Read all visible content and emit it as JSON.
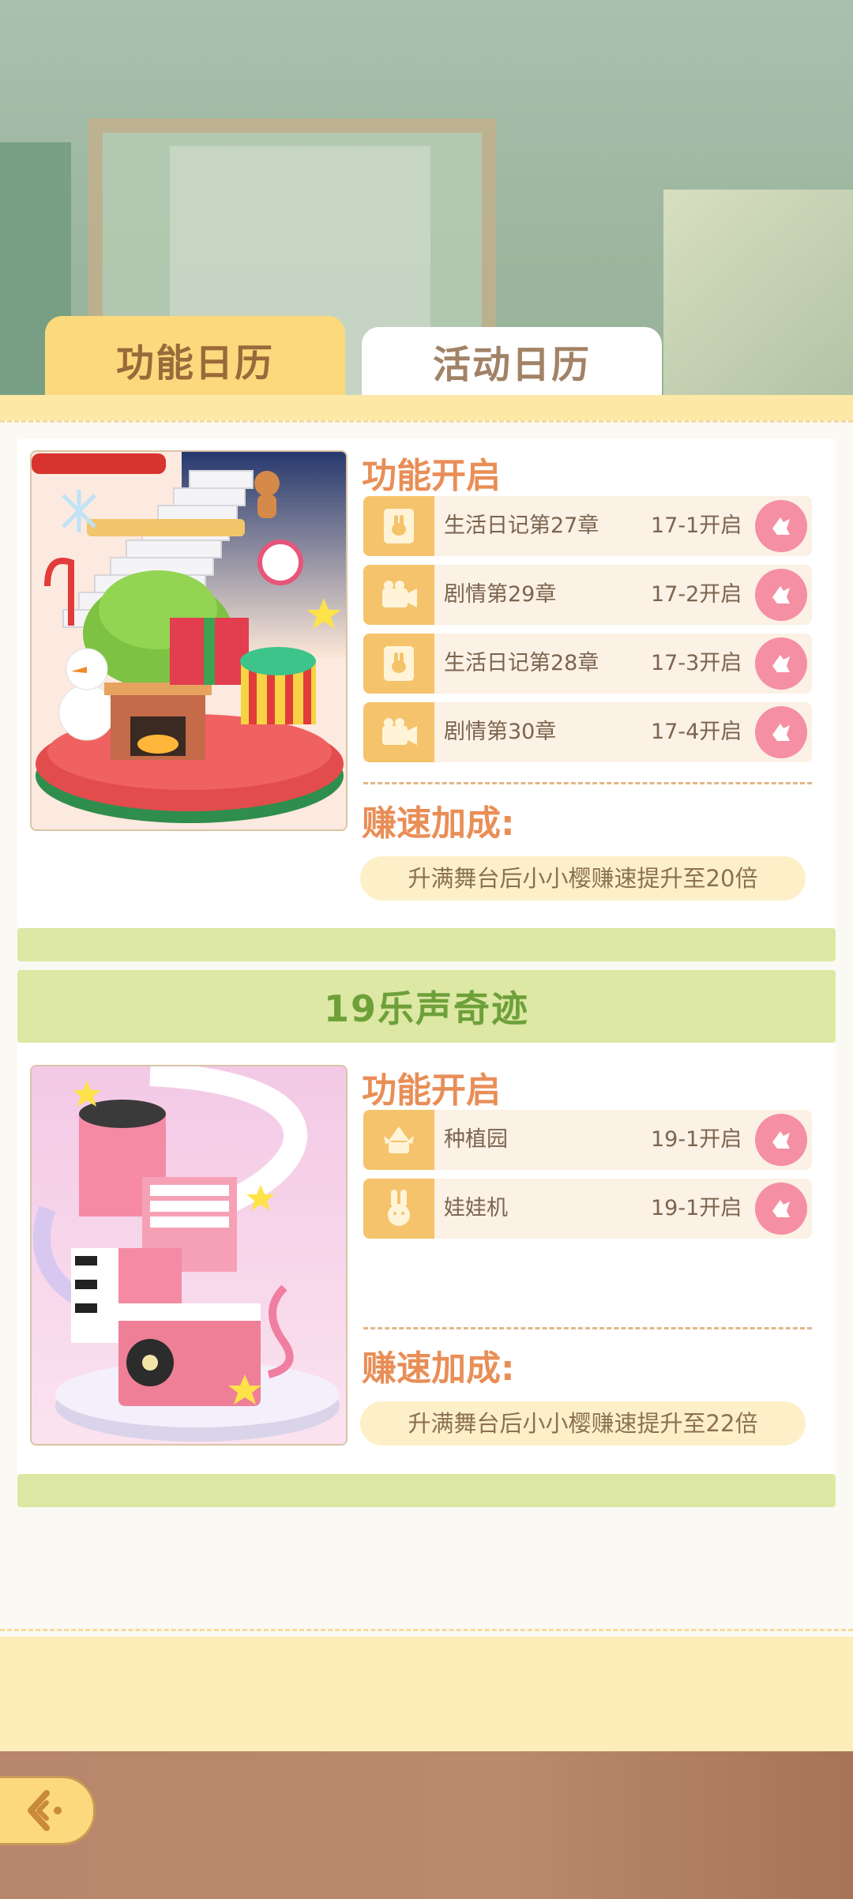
{
  "tabs": [
    {
      "label": "功能日历",
      "active": true
    },
    {
      "label": "活动日历",
      "active": false
    }
  ],
  "sections": [
    {
      "title": "",
      "image": "christmas-stage-image",
      "feature_heading": "功能开启",
      "features": [
        {
          "icon": "rabbit-diary-icon",
          "name": "生活日记第27章",
          "open": "17-1开启"
        },
        {
          "icon": "camera-icon",
          "name": "剧情第29章",
          "open": "17-2开启"
        },
        {
          "icon": "rabbit-diary-icon",
          "name": "生活日记第28章",
          "open": "17-3开启"
        },
        {
          "icon": "camera-icon",
          "name": "剧情第30章",
          "open": "17-4开启"
        }
      ],
      "speed_heading": "赚速加成:",
      "speed_text": "升满舞台后小小樱赚速提升至20倍"
    },
    {
      "title": "19乐声奇迹",
      "image": "music-stage-image",
      "feature_heading": "功能开启",
      "features": [
        {
          "icon": "plant-icon",
          "name": "种植园",
          "open": "19-1开启"
        },
        {
          "icon": "rabbit-icon",
          "name": "娃娃机",
          "open": "19-1开启"
        }
      ],
      "speed_heading": "赚速加成:",
      "speed_text": "升满舞台后小小樱赚速提升至22倍"
    }
  ],
  "colors": {
    "accent_yellow": "#fcd97d",
    "section_green": "#dce8a3",
    "title_green": "#6ea03a",
    "heading_orange": "#e98e57",
    "go_button_pink": "#f58fa3"
  },
  "back_button": {
    "icon": "back-arrow-icon"
  }
}
